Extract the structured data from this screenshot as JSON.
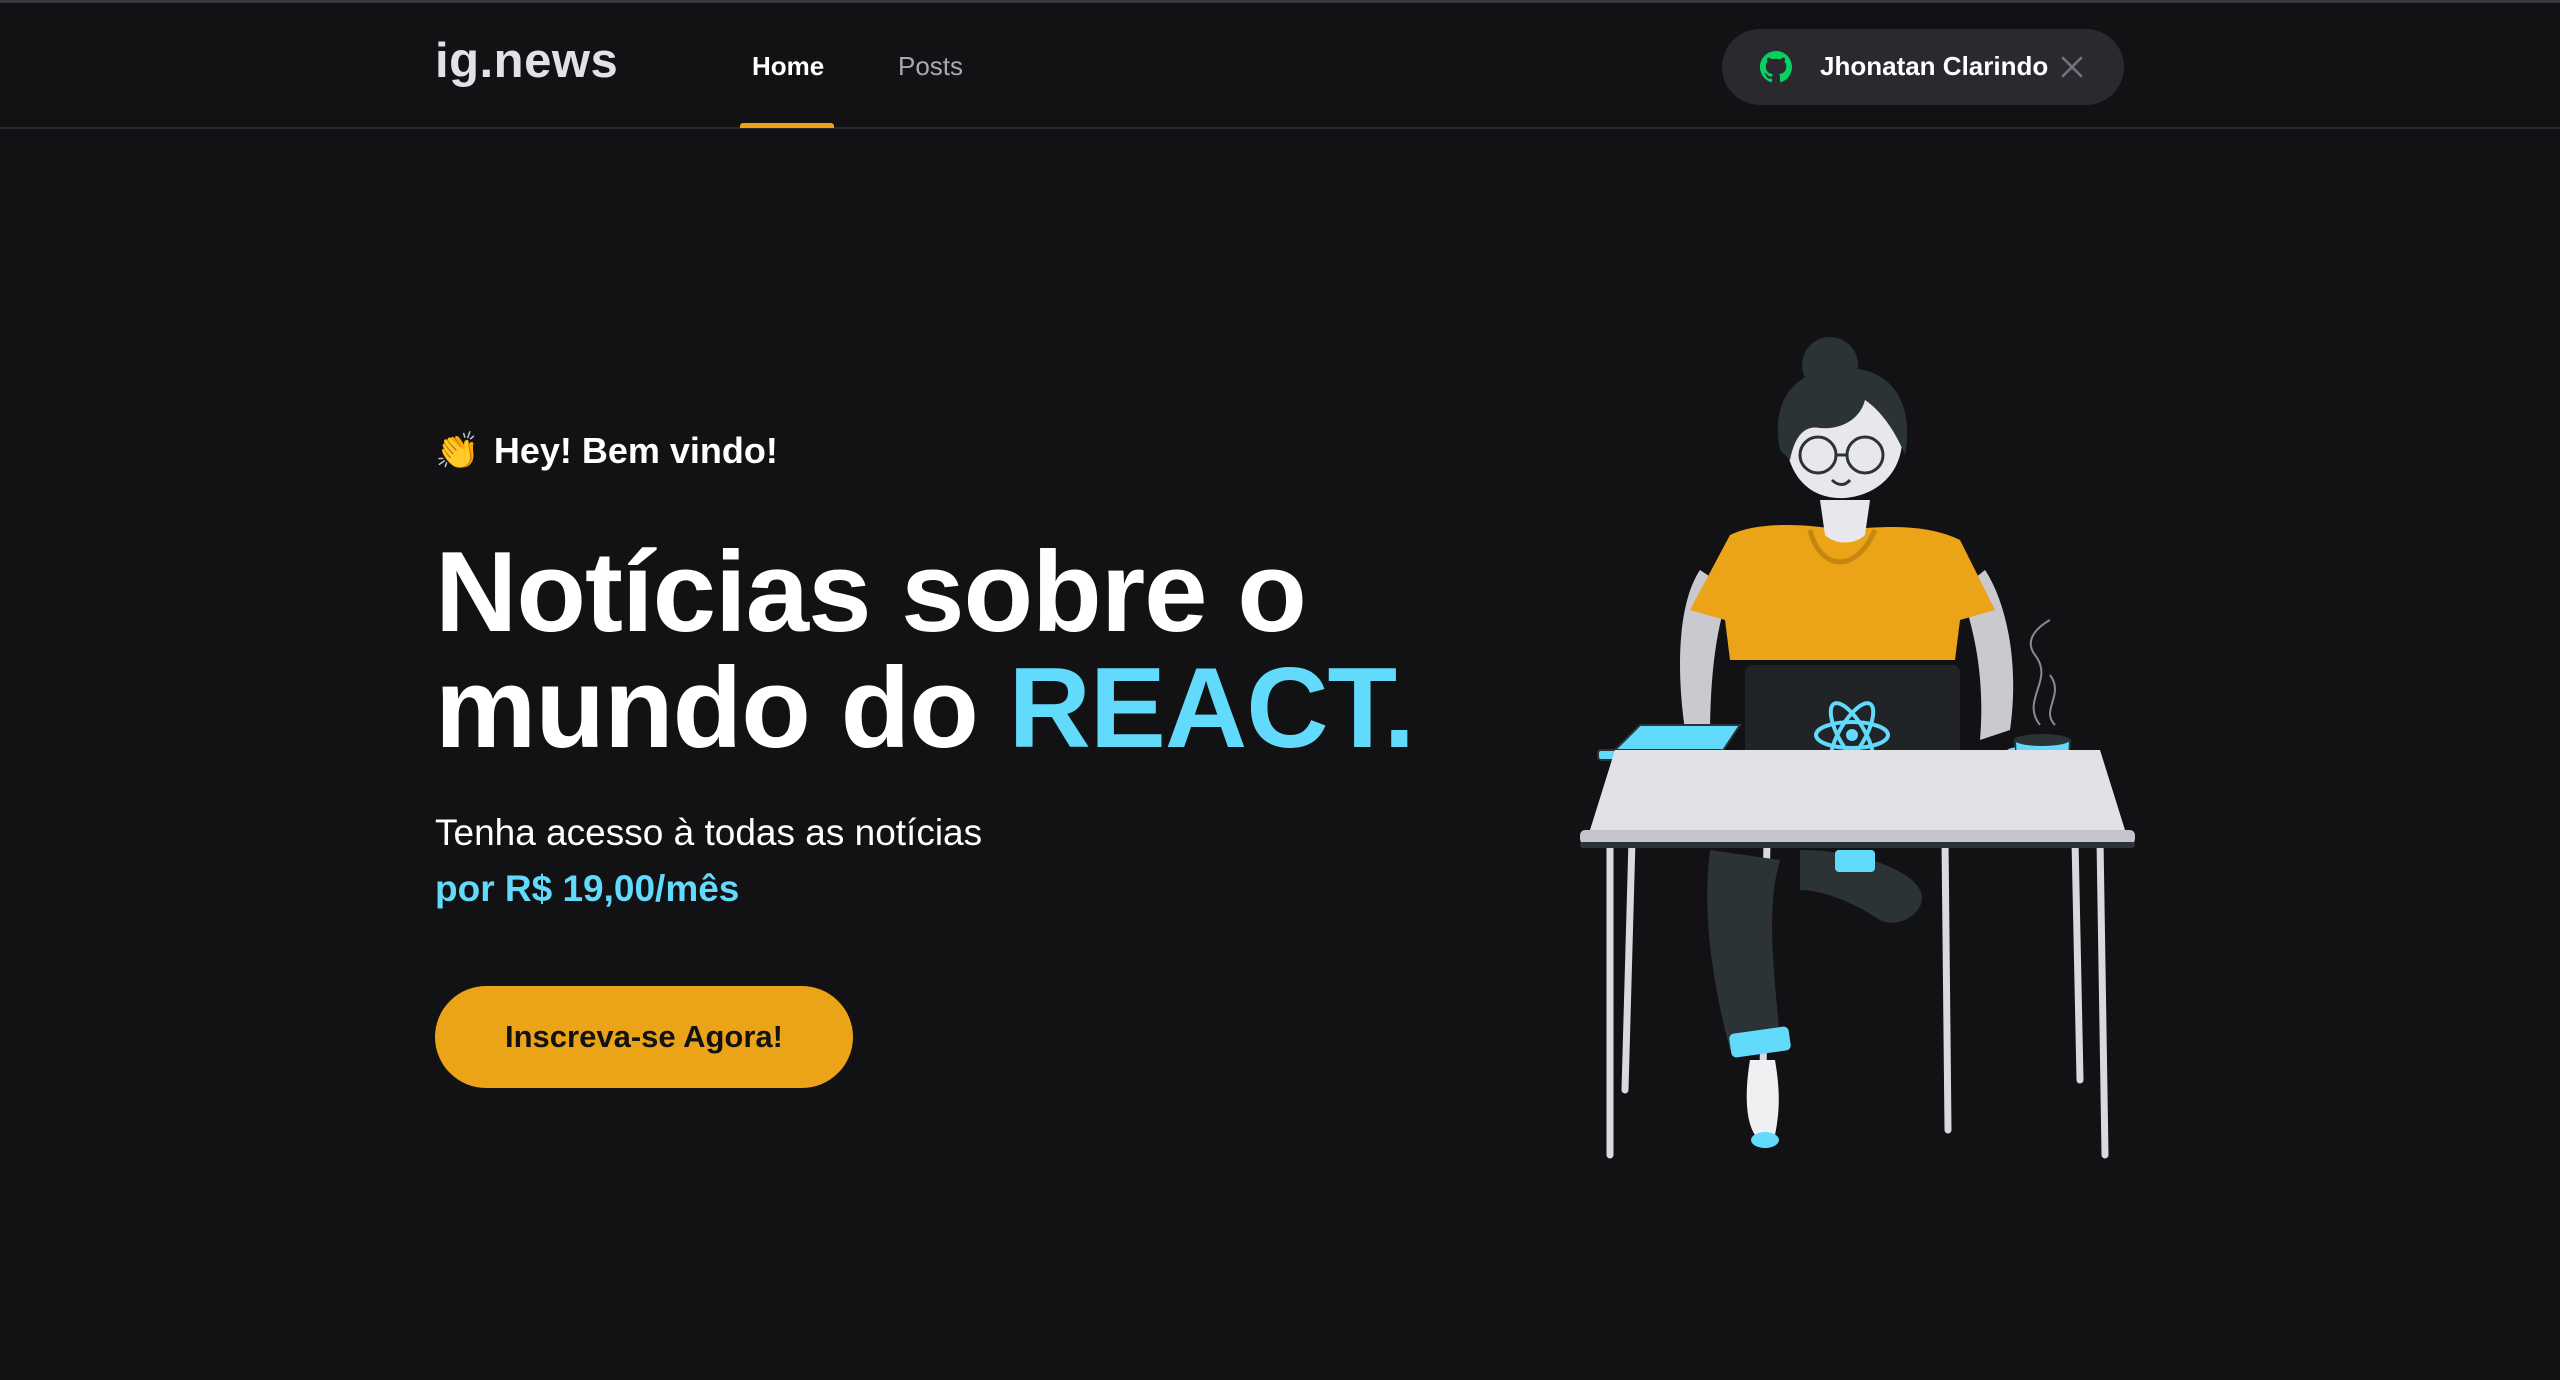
{
  "header": {
    "logo": "ig.news",
    "nav": [
      {
        "label": "Home",
        "active": true
      },
      {
        "label": "Posts",
        "active": false
      }
    ],
    "user": {
      "name": "Jhonatan Clarindo",
      "icon": "github-icon",
      "close_icon": "close-icon"
    }
  },
  "hero": {
    "welcome_emoji": "👏",
    "welcome": "Hey! Bem vindo!",
    "headline_line1": "Notícias sobre o",
    "headline_line2_prefix": "mundo do ",
    "headline_accent": "REACT.",
    "subtitle": "Tenha acesso à todas as notícias",
    "price": "por R$ 19,00/mês",
    "cta_label": "Inscreva-se Agora!"
  },
  "colors": {
    "background": "#121214",
    "accent_yellow": "#eba417",
    "accent_cyan": "#61dafb",
    "github_green": "#04d361",
    "button_dark": "#29292e"
  }
}
